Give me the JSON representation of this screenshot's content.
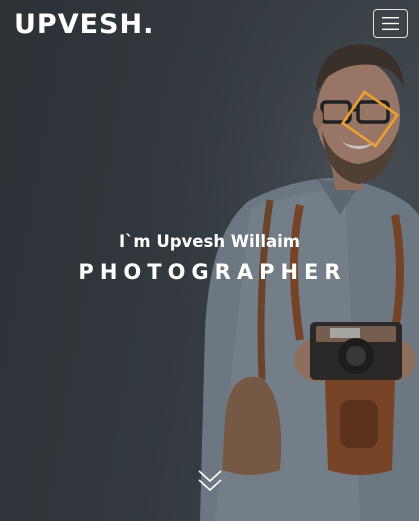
{
  "header": {
    "brand": "UPVESH.",
    "menu_icon": "hamburger-icon"
  },
  "hero": {
    "intro": "I`m Upvesh Willaim",
    "role": "PHOTOGRAPHER",
    "scroll_icon": "double-chevron-down-icon"
  },
  "colors": {
    "overlay": "#30363c",
    "accent_frame": "#f0a030",
    "text": "#ffffff"
  }
}
